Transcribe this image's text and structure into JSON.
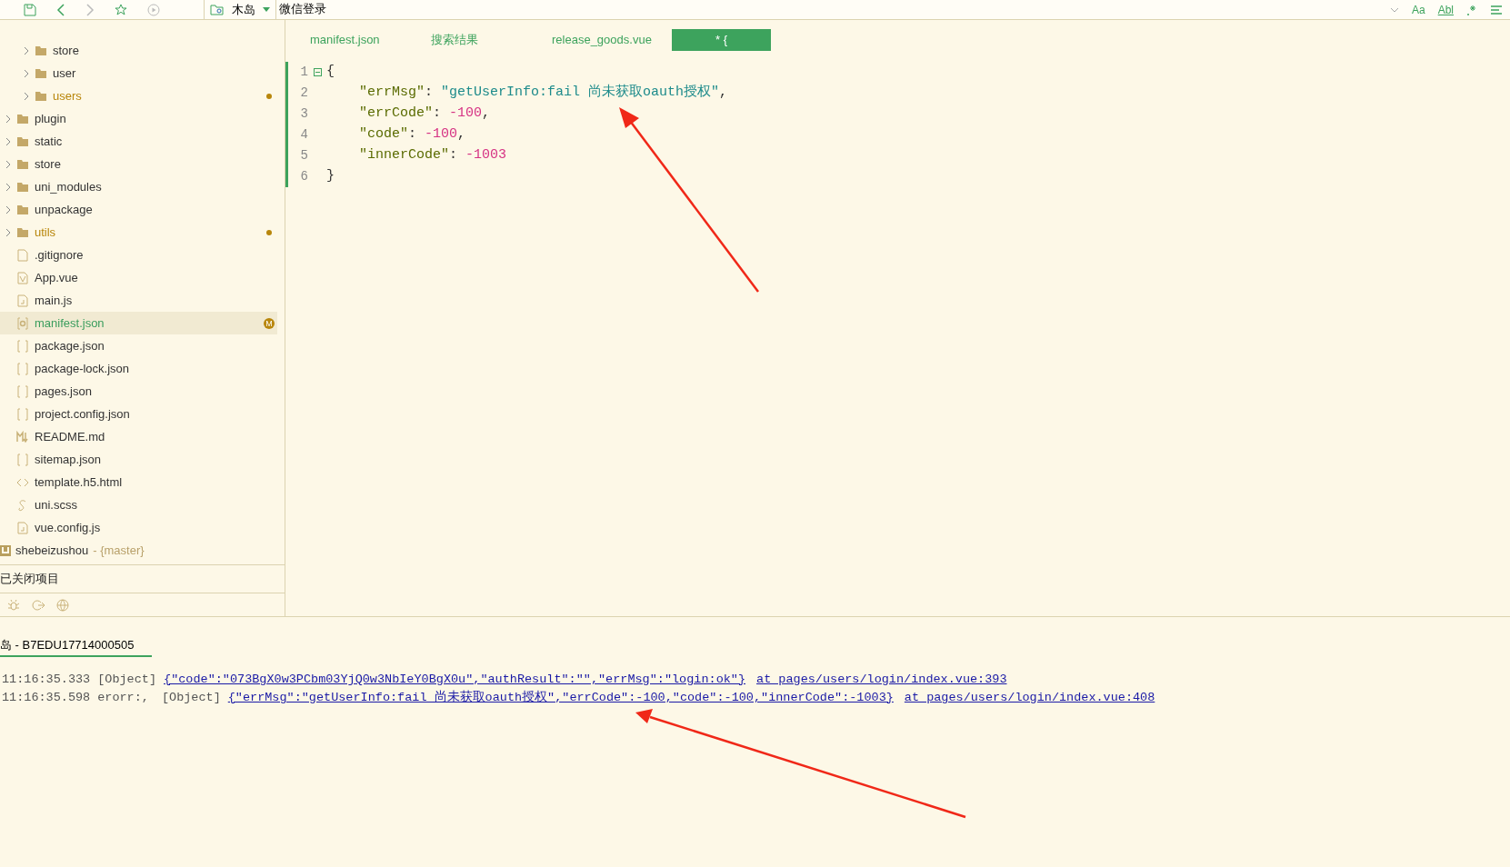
{
  "toolbar": {
    "project": "木岛",
    "page": "微信登录",
    "right_texts": [
      "Aa",
      "Abl"
    ]
  },
  "tabs": [
    {
      "label": "manifest.json",
      "selected": false
    },
    {
      "label": "搜索结果",
      "selected": false
    },
    {
      "label": "release_goods.vue",
      "selected": false
    },
    {
      "label": "* {",
      "selected": true
    }
  ],
  "tree": {
    "nested_items": [
      {
        "label": "store",
        "kind": "folder",
        "modified": false,
        "selected": false
      },
      {
        "label": "user",
        "kind": "folder",
        "modified": false,
        "selected": false
      },
      {
        "label": "users",
        "kind": "folder",
        "modified": true,
        "selected": false
      }
    ],
    "items": [
      {
        "label": "plugin",
        "kind": "folder",
        "modified": false,
        "selected": false
      },
      {
        "label": "static",
        "kind": "folder",
        "modified": false,
        "selected": false
      },
      {
        "label": "store",
        "kind": "folder",
        "modified": false,
        "selected": false
      },
      {
        "label": "uni_modules",
        "kind": "folder",
        "modified": false,
        "selected": false
      },
      {
        "label": "unpackage",
        "kind": "folder",
        "modified": false,
        "selected": false
      },
      {
        "label": "utils",
        "kind": "folder",
        "modified": true,
        "selected": false
      },
      {
        "label": ".gitignore",
        "kind": "blank",
        "modified": false,
        "selected": false
      },
      {
        "label": "App.vue",
        "kind": "vue",
        "modified": false,
        "selected": false
      },
      {
        "label": "main.js",
        "kind": "js",
        "modified": false,
        "selected": false
      },
      {
        "label": "manifest.json",
        "kind": "config",
        "modified": true,
        "badge": "M",
        "selected": true
      },
      {
        "label": "package.json",
        "kind": "json",
        "modified": false,
        "selected": false
      },
      {
        "label": "package-lock.json",
        "kind": "json",
        "modified": false,
        "selected": false
      },
      {
        "label": "pages.json",
        "kind": "json",
        "modified": false,
        "selected": false
      },
      {
        "label": "project.config.json",
        "kind": "json",
        "modified": false,
        "selected": false
      },
      {
        "label": "README.md",
        "kind": "markdown",
        "modified": false,
        "selected": false
      },
      {
        "label": "sitemap.json",
        "kind": "json",
        "modified": false,
        "selected": false
      },
      {
        "label": "template.h5.html",
        "kind": "html",
        "modified": false,
        "selected": false
      },
      {
        "label": "uni.scss",
        "kind": "scss",
        "modified": false,
        "selected": false
      },
      {
        "label": "vue.config.js",
        "kind": "js",
        "modified": false,
        "selected": false
      }
    ],
    "project": {
      "name": "shebeizushou",
      "branch": "- {master}"
    }
  },
  "closed_projects": "已关闭项目",
  "code_lines": [
    {
      "number": "1",
      "fold": true,
      "tokens": [
        {
          "kind": "punct",
          "text": "{"
        }
      ]
    },
    {
      "number": "2",
      "fold": false,
      "tokens": [
        {
          "kind": "key",
          "text": "    \"errMsg\""
        },
        {
          "kind": "punct",
          "text": ": "
        },
        {
          "kind": "string",
          "text": "\"getUserInfo:fail 尚未获取oauth授权\""
        },
        {
          "kind": "punct",
          "text": ","
        }
      ]
    },
    {
      "number": "3",
      "fold": false,
      "tokens": [
        {
          "kind": "key",
          "text": "    \"errCode\""
        },
        {
          "kind": "punct",
          "text": ": "
        },
        {
          "kind": "number",
          "text": "-100"
        },
        {
          "kind": "punct",
          "text": ","
        }
      ]
    },
    {
      "number": "4",
      "fold": false,
      "tokens": [
        {
          "kind": "key",
          "text": "    \"code\""
        },
        {
          "kind": "punct",
          "text": ": "
        },
        {
          "kind": "number",
          "text": "-100"
        },
        {
          "kind": "punct",
          "text": ","
        }
      ]
    },
    {
      "number": "5",
      "fold": false,
      "tokens": [
        {
          "kind": "key",
          "text": "    \"innerCode\""
        },
        {
          "kind": "punct",
          "text": ": "
        },
        {
          "kind": "number",
          "text": "-1003"
        }
      ]
    },
    {
      "number": "6",
      "fold": false,
      "tokens": [
        {
          "kind": "punct",
          "text": "}"
        }
      ]
    }
  ],
  "console": {
    "title": "岛 - B7EDU17714000505",
    "lines": [
      {
        "time": "11:16:35.333",
        "tag": "[Object]",
        "object": "{\"code\":\"073BgX0w3PCbm03YjQ0w3NbIeY0BgX0u\",\"authResult\":\"\",\"errMsg\":\"login:ok\"}",
        "location": "at pages/users/login/index.vue:393"
      },
      {
        "time": "11:16:35.598",
        "prefix": "erorr:,",
        "tag": "[Object]",
        "object": "{\"errMsg\":\"getUserInfo:fail 尚未获取oauth授权\",\"errCode\":-100,\"code\":-100,\"innerCode\":-1003}",
        "location": "at pages/users/login/index.vue:408"
      }
    ]
  }
}
